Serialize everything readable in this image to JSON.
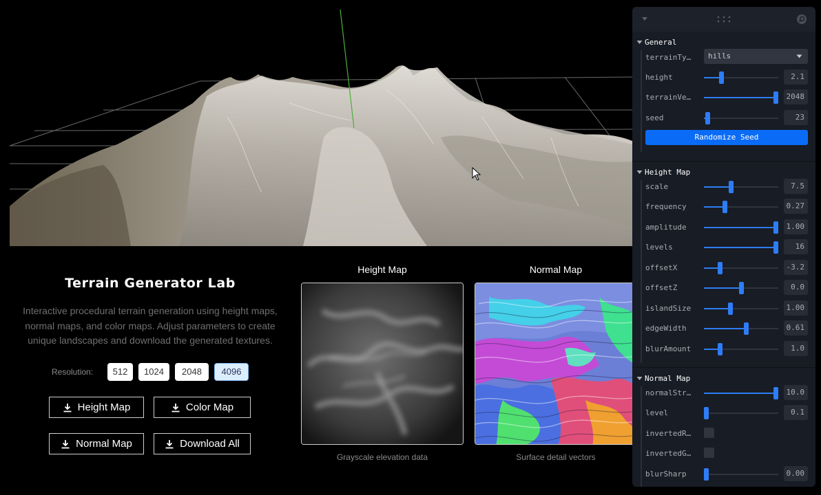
{
  "viewport": {
    "name": "terrain-3d-view"
  },
  "info": {
    "title": "Terrain Generator Lab",
    "description": "Interactive procedural terrain generation using height maps, normal maps, and color maps. Adjust parameters to create unique landscapes and download the generated textures.",
    "resolution_label": "Resolution:",
    "resolutions": [
      "512",
      "1024",
      "2048",
      "4096"
    ],
    "selected_resolution": "4096",
    "buttons": {
      "height_map": "Height Map",
      "color_map": "Color Map",
      "normal_map": "Normal Map",
      "download_all": "Download All"
    }
  },
  "previews": {
    "height": {
      "title": "Height Map",
      "caption": "Grayscale elevation data"
    },
    "normal": {
      "title": "Normal Map",
      "caption": "Surface detail vectors"
    }
  },
  "panel": {
    "general": {
      "title": "General",
      "terrain_type": {
        "label": "terrainTy…",
        "value": "hills"
      },
      "height": {
        "label": "height",
        "value": "2.1",
        "fraction": 0.22
      },
      "terrain_vertices": {
        "label": "terrainVe…",
        "value": "2048",
        "fraction": 1.0
      },
      "seed": {
        "label": "seed",
        "value": "23",
        "fraction": 0.02
      },
      "randomize": "Randomize Seed"
    },
    "height_map": {
      "title": "Height Map",
      "scale": {
        "label": "scale",
        "value": "7.5",
        "fraction": 0.36
      },
      "frequency": {
        "label": "frequency",
        "value": "0.27",
        "fraction": 0.27
      },
      "amplitude": {
        "label": "amplitude",
        "value": "1.00",
        "fraction": 1.0
      },
      "levels": {
        "label": "levels",
        "value": "16",
        "fraction": 1.0
      },
      "offsetX": {
        "label": "offsetX",
        "value": "-3.2",
        "fraction": 0.2
      },
      "offsetZ": {
        "label": "offsetZ",
        "value": "0.0",
        "fraction": 0.5
      },
      "islandSize": {
        "label": "islandSize",
        "value": "1.00",
        "fraction": 0.35
      },
      "edgeWidth": {
        "label": "edgeWidth",
        "value": "0.61",
        "fraction": 0.57
      },
      "blurAmount": {
        "label": "blurAmount",
        "value": "1.0",
        "fraction": 0.2
      }
    },
    "normal_map": {
      "title": "Normal Map",
      "normalStrength": {
        "label": "normalStr…",
        "value": "10.0",
        "fraction": 1.0
      },
      "level": {
        "label": "level",
        "value": "0.1",
        "fraction": 0.0
      },
      "invertedR": {
        "label": "invertedR…",
        "checked": false
      },
      "invertedG": {
        "label": "invertedG…",
        "checked": false
      },
      "blurSharp": {
        "label": "blurSharp",
        "value": "0.00",
        "fraction": 0.0
      }
    }
  },
  "colors": {
    "accent": "#2e7df6",
    "button": "#0a6cf6",
    "panel_bg": "#181c24"
  }
}
